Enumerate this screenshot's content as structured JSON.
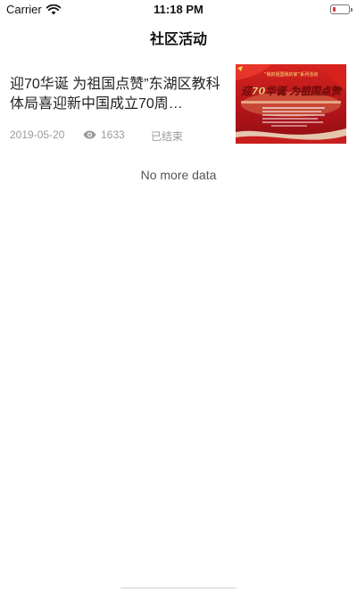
{
  "status_bar": {
    "carrier": "Carrier",
    "time": "11:18 PM",
    "battery_color": "#e0353c"
  },
  "nav": {
    "title": "社区活动"
  },
  "items": [
    {
      "title": "迎70华诞 为祖国点赞”东湖区教科体局喜迎新中国成立70周…",
      "date": "2019-05-20",
      "views": "1633",
      "status": "已结束",
      "thumb": {
        "banner_text": "迎70华诞  为祖国点赞",
        "top_tag": "“我的祖国我的家”系列活动"
      }
    }
  ],
  "footer": {
    "no_more": "No more data"
  },
  "icons": {
    "wifi": "wifi-icon",
    "battery": "battery-icon",
    "views": "eye-icon"
  }
}
